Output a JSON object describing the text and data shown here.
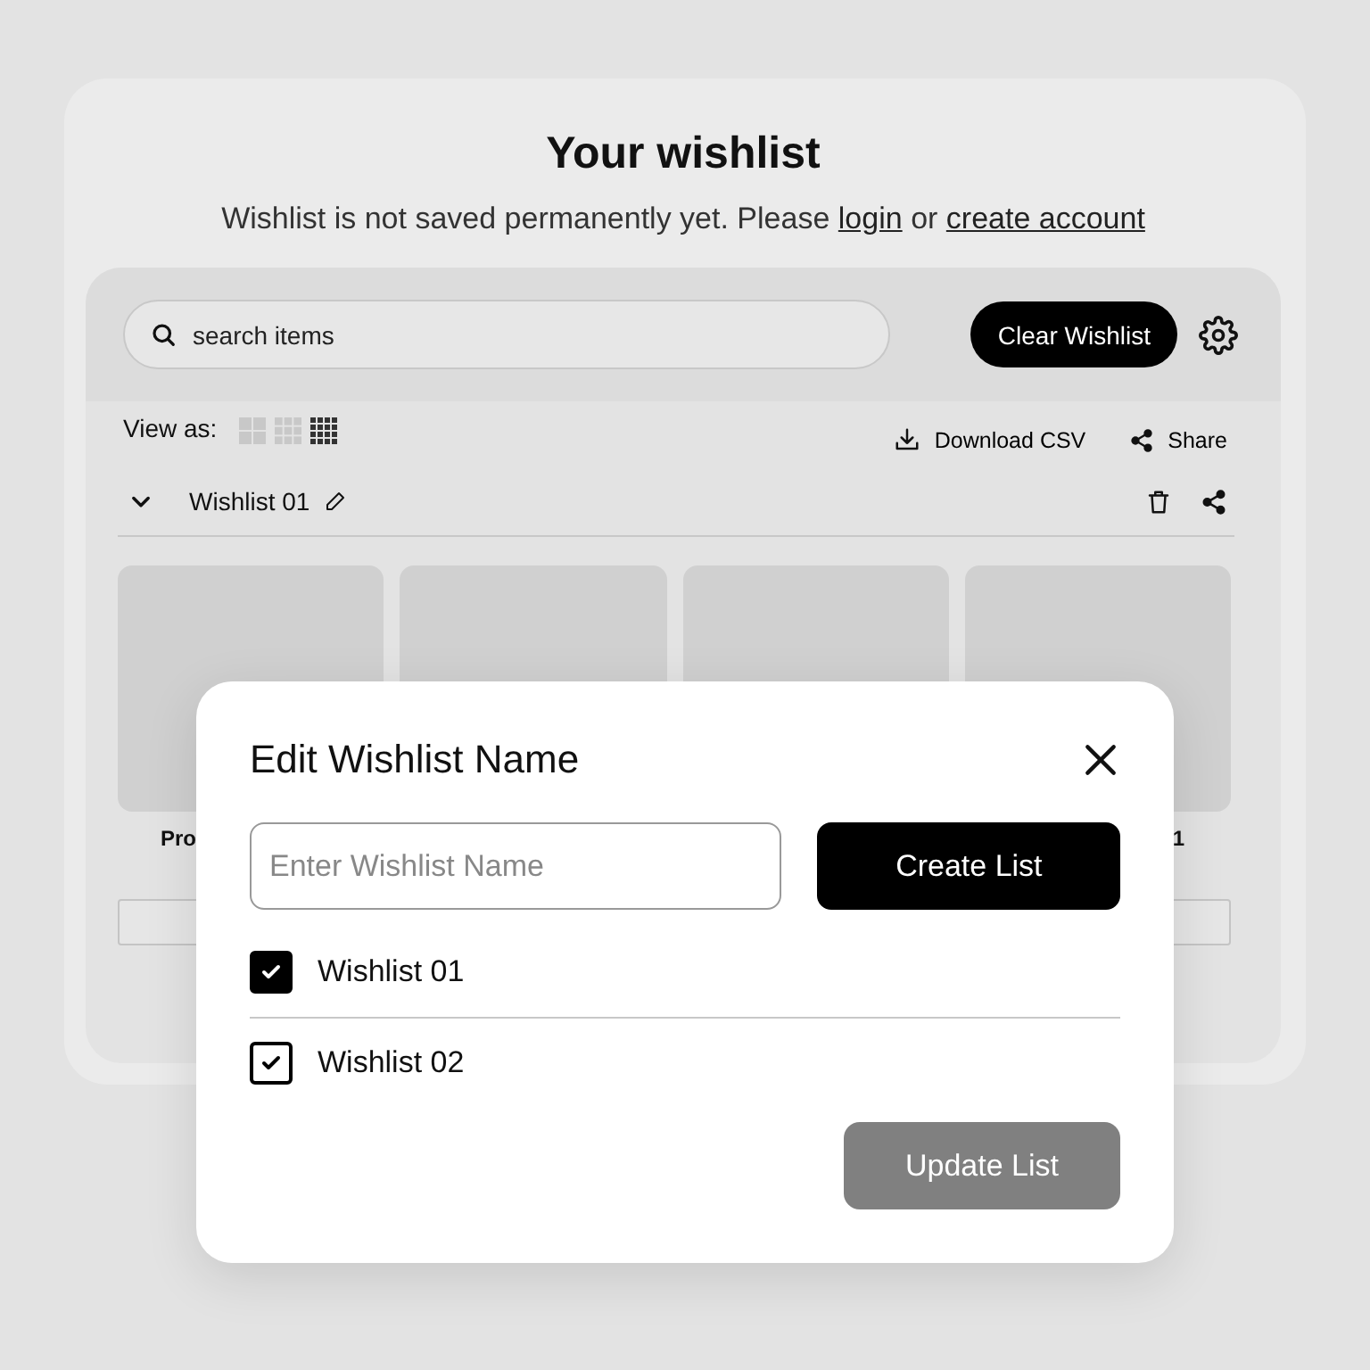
{
  "title": "Your wishlist",
  "notice": {
    "text": "Wishlist is not saved permanently yet. Please",
    "login": "login",
    "or": "or",
    "create": "create account"
  },
  "search": {
    "placeholder": "search items"
  },
  "clear_button": "Clear Wishlist",
  "view": {
    "label": "View as:",
    "options": [
      {
        "selected": false,
        "kind": "large"
      },
      {
        "selected": false,
        "kind": "medium"
      },
      {
        "selected": true,
        "kind": "small"
      }
    ]
  },
  "actions": [
    "Download CSV",
    "Share"
  ],
  "wishlist": {
    "name": "Wishlist 01",
    "expanded": true
  },
  "cards": [
    {
      "kind": "product",
      "label": "Pro"
    },
    {
      "kind": "product"
    },
    {
      "kind": "product"
    },
    {
      "kind": "product",
      "label": "1"
    }
  ],
  "dialog": {
    "title": "Edit Wishlist Name",
    "input": {
      "placeholder": "Enter Wishlist Name"
    },
    "create_button": "Create List",
    "lists": [
      {
        "name": "Wishlist 01",
        "checked": true,
        "kind": "filled"
      },
      {
        "name": "Wishlist 02",
        "checked": true,
        "kind": "outline"
      }
    ],
    "update_button": {
      "label": "Update List",
      "disabled": true
    }
  }
}
